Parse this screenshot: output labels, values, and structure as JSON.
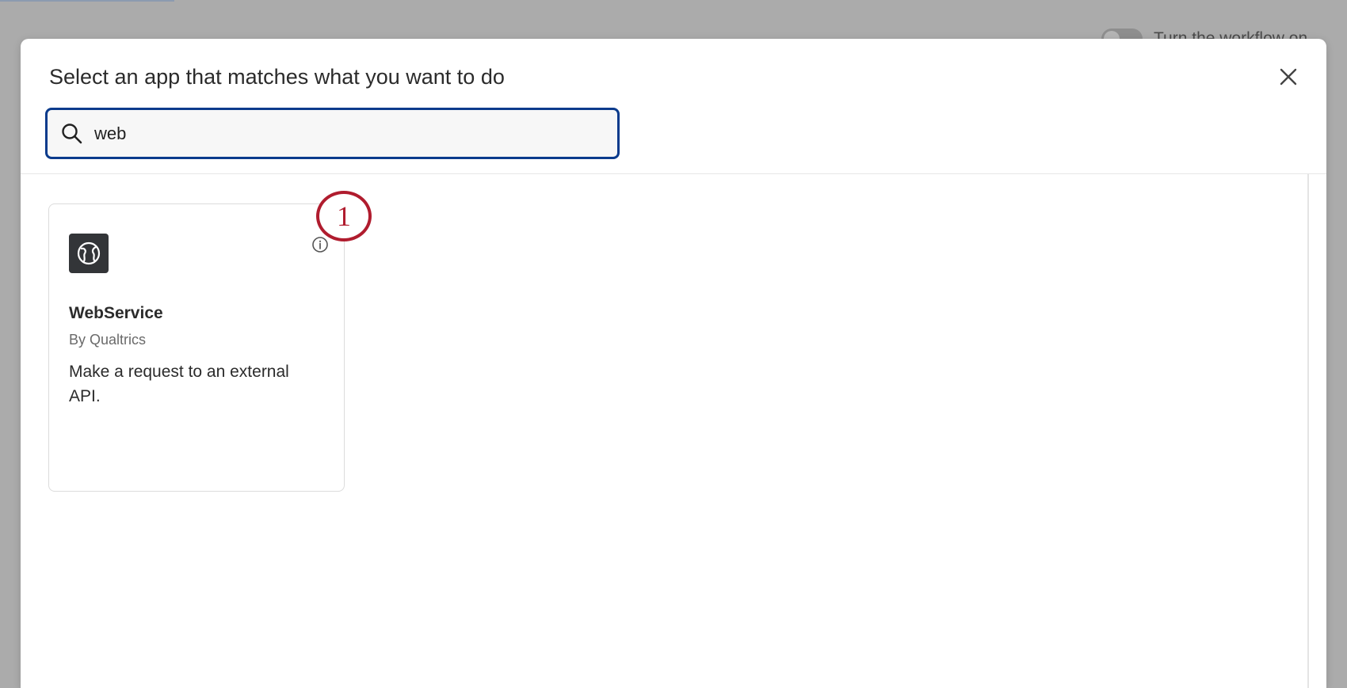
{
  "background": {
    "toggle_label": "Turn the workflow on"
  },
  "modal": {
    "title": "Select an app that matches what you want to do",
    "close_icon": "close-icon"
  },
  "search": {
    "value": "web",
    "icon": "search-icon"
  },
  "results": [
    {
      "name": "WebService",
      "vendor": "By Qualtrics",
      "description": "Make a request to an external API.",
      "logo_icon": "globe-icon",
      "info_icon": "info-icon"
    }
  ],
  "annotation": {
    "number": "1",
    "color": "#b01c2e"
  },
  "colors": {
    "search_border": "#0b3b8c",
    "logo_bg": "#333538"
  }
}
